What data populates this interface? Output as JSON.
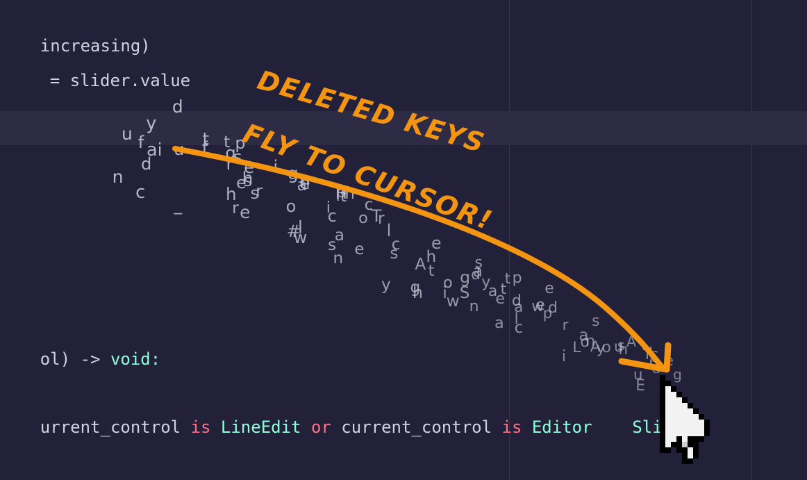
{
  "code": {
    "line1": {
      "tail": "increasing)"
    },
    "line2": {
      "tail": "= slider.value"
    },
    "line3": {
      "tail": "ol) -> ",
      "type": "void:"
    },
    "line4": {
      "t1": "urrent_control ",
      "k1": "is",
      "t2": " ",
      "type1": "LineEdit",
      "t3": " ",
      "k2": "or",
      "t4": " current_control ",
      "k3": "is",
      "t5": " ",
      "type2": "Editor",
      "t6": "    ",
      "type3": "Slider:"
    }
  },
  "annotation": {
    "line1": "DELETED KEYS",
    "line2": "FLY TO CURSOR!",
    "color": "#f39512"
  },
  "flying_keys": [
    "f",
    "u",
    "n",
    "y",
    "d",
    "d",
    "u",
    "c",
    "a",
    "i",
    "t",
    "s",
    "f",
    "g",
    "_",
    "e",
    "r",
    "p",
    "t",
    "h",
    "i",
    "h",
    "s",
    "r",
    "e",
    "l",
    "o",
    "e",
    "r",
    "e",
    "s",
    "g",
    "w",
    "n",
    "H",
    "#",
    "s",
    "h",
    "a",
    "e",
    "p",
    "t",
    "c",
    "i",
    "c",
    "a",
    "n",
    "l",
    "s",
    "T",
    "o",
    "r",
    "c",
    "h",
    "y",
    "g",
    "h",
    "A",
    "i",
    "g",
    "e",
    "o",
    "S",
    "w",
    "t",
    "a",
    "s",
    "d",
    "t",
    "a",
    "n",
    "d",
    "p",
    "a",
    "y",
    "e",
    "t",
    "w",
    "e",
    "a",
    "c",
    "l",
    "e",
    "d",
    "L",
    "o",
    "p",
    "a",
    "r",
    "i",
    "y",
    "s",
    "u",
    "A",
    "n",
    "h",
    "s",
    "o",
    "u",
    "T",
    "I",
    "A",
    "E",
    "d",
    "c",
    "e",
    "e",
    "g"
  ]
}
